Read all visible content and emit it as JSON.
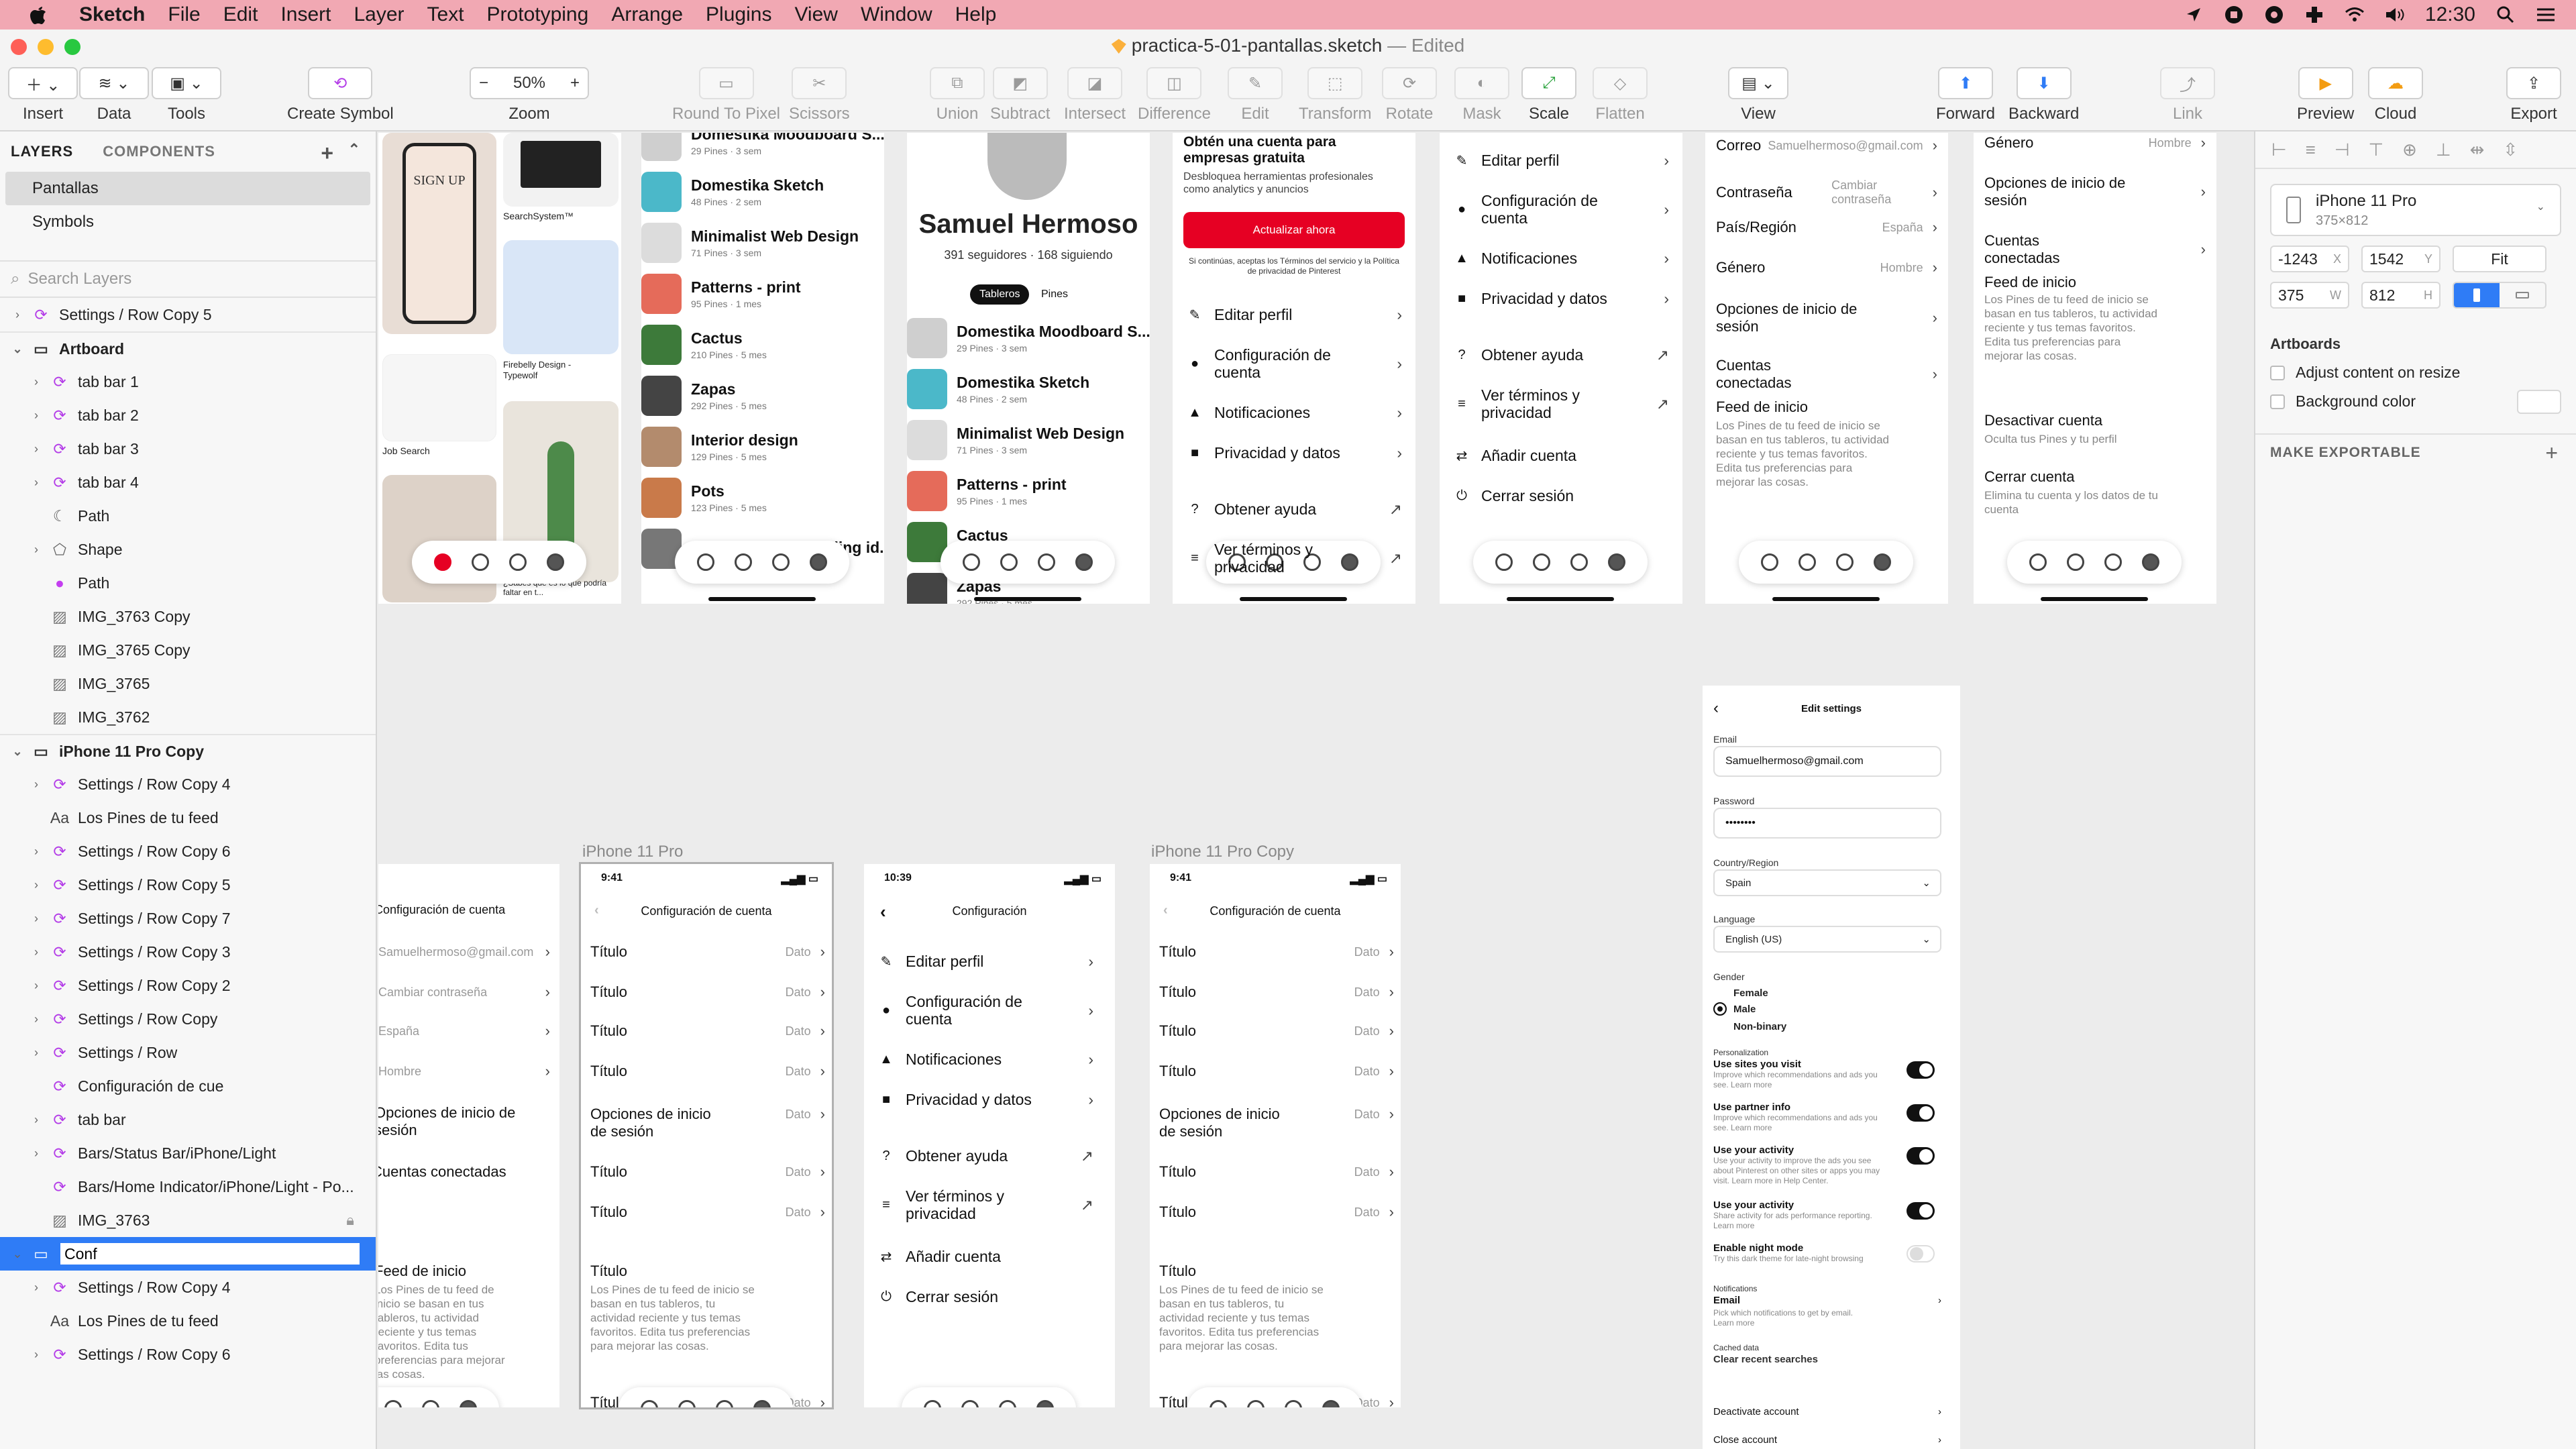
{
  "menubar": {
    "items": [
      "Sketch",
      "File",
      "Edit",
      "Insert",
      "Layer",
      "Text",
      "Prototyping",
      "Arrange",
      "Plugins",
      "View",
      "Window",
      "Help"
    ],
    "time": "12:30"
  },
  "window": {
    "title": "practica-5-01-pantallas.sketch",
    "edited": "— Edited"
  },
  "toolbar": {
    "insert": "Insert",
    "data": "Data",
    "tools": "Tools",
    "create_symbol": "Create Symbol",
    "zoom_value": "50%",
    "zoom": "Zoom",
    "round_to_pixel": "Round To Pixel",
    "scissors": "Scissors",
    "union": "Union",
    "subtract": "Subtract",
    "intersect": "Intersect",
    "difference": "Difference",
    "edit": "Edit",
    "transform": "Transform",
    "rotate": "Rotate",
    "mask": "Mask",
    "scale": "Scale",
    "flatten": "Flatten",
    "view": "View",
    "forward": "Forward",
    "backward": "Backward",
    "link": "Link",
    "preview": "Preview",
    "cloud": "Cloud",
    "export": "Export"
  },
  "left_panel": {
    "tab_layers": "LAYERS",
    "tab_components": "COMPONENTS",
    "pages": [
      "Pantallas",
      "Symbols"
    ],
    "search_placeholder": "Search Layers",
    "layers": [
      {
        "name": "Settings / Row Copy 5",
        "icon": "symbol-icon",
        "indent": 0,
        "arrow": "›"
      },
      {
        "name": "Artboard",
        "icon": "artboard-icon",
        "indent": 0,
        "arrow": "⌄",
        "group": true
      },
      {
        "name": "tab bar 1",
        "icon": "symbol-icon",
        "indent": 1,
        "arrow": "›"
      },
      {
        "name": "tab bar 2",
        "icon": "symbol-icon",
        "indent": 1,
        "arrow": "›"
      },
      {
        "name": "tab bar 3",
        "icon": "symbol-icon",
        "indent": 1,
        "arrow": "›"
      },
      {
        "name": "tab bar 4",
        "icon": "symbol-icon",
        "indent": 1,
        "arrow": "›"
      },
      {
        "name": "Path",
        "icon": "path-icon",
        "indent": 1,
        "arrow": ""
      },
      {
        "name": "Shape",
        "icon": "shape-icon",
        "indent": 1,
        "arrow": "›"
      },
      {
        "name": "Path",
        "icon": "path-pink-icon",
        "indent": 1,
        "arrow": ""
      },
      {
        "name": "IMG_3763 Copy",
        "icon": "image-icon",
        "indent": 1,
        "arrow": ""
      },
      {
        "name": "IMG_3765 Copy",
        "icon": "image-icon",
        "indent": 1,
        "arrow": ""
      },
      {
        "name": "IMG_3765",
        "icon": "image-icon",
        "indent": 1,
        "arrow": ""
      },
      {
        "name": "IMG_3762",
        "icon": "image-icon",
        "indent": 1,
        "arrow": ""
      },
      {
        "name": "iPhone 11 Pro Copy",
        "icon": "artboard-icon",
        "indent": 0,
        "arrow": "⌄",
        "group": true
      },
      {
        "name": "Settings / Row Copy 4",
        "icon": "symbol-icon",
        "indent": 1,
        "arrow": "›"
      },
      {
        "name": "Los Pines de tu feed",
        "icon": "text-icon",
        "indent": 1,
        "arrow": ""
      },
      {
        "name": "Settings / Row Copy 6",
        "icon": "symbol-icon",
        "indent": 1,
        "arrow": "›"
      },
      {
        "name": "Settings / Row Copy 5",
        "icon": "symbol-icon",
        "indent": 1,
        "arrow": "›"
      },
      {
        "name": "Settings / Row Copy 7",
        "icon": "symbol-icon",
        "indent": 1,
        "arrow": "›"
      },
      {
        "name": "Settings / Row Copy 3",
        "icon": "symbol-icon",
        "indent": 1,
        "arrow": "›"
      },
      {
        "name": "Settings / Row Copy 2",
        "icon": "symbol-icon",
        "indent": 1,
        "arrow": "›"
      },
      {
        "name": "Settings / Row Copy",
        "icon": "symbol-icon",
        "indent": 1,
        "arrow": "›"
      },
      {
        "name": "Settings / Row",
        "icon": "symbol-icon",
        "indent": 1,
        "arrow": "›"
      },
      {
        "name": "Configuración de cue",
        "icon": "symbol-icon",
        "indent": 1,
        "arrow": ""
      },
      {
        "name": "tab bar",
        "icon": "symbol-icon",
        "indent": 1,
        "arrow": "›"
      },
      {
        "name": "Bars/Status Bar/iPhone/Light",
        "icon": "symbol-icon",
        "indent": 1,
        "arrow": "›"
      },
      {
        "name": "Bars/Home Indicator/iPhone/Light - Po...",
        "icon": "symbol-icon",
        "indent": 1,
        "arrow": ""
      },
      {
        "name": "IMG_3763",
        "icon": "image-icon",
        "indent": 1,
        "arrow": "",
        "locked": true
      },
      {
        "name": "Conf",
        "icon": "artboard-icon",
        "indent": 0,
        "arrow": "⌄",
        "editing": true
      },
      {
        "name": "Settings / Row Copy 4",
        "icon": "symbol-icon",
        "indent": 1,
        "arrow": "›"
      },
      {
        "name": "Los Pines de tu feed",
        "icon": "text-icon",
        "indent": 1,
        "arrow": ""
      },
      {
        "name": "Settings / Row Copy 6",
        "icon": "symbol-icon",
        "indent": 1,
        "arrow": "›"
      }
    ]
  },
  "inspector": {
    "device_name": "iPhone 11 Pro",
    "device_size": "375×812",
    "x": "-1243",
    "x_unit": "X",
    "y": "1542",
    "y_unit": "Y",
    "w": "375",
    "w_unit": "W",
    "h": "812",
    "h_unit": "H",
    "fit": "Fit",
    "artboards_title": "Artboards",
    "adjust": "Adjust content on resize",
    "bg_color": "Background color",
    "exportable": "MAKE EXPORTABLE"
  },
  "canvas": {
    "signup_text": "SIGN UP",
    "search_system": "SearchSystem™",
    "firebelly": "Firebelly Design - Typewolf",
    "job_search": "Job Search",
    "saber": "¿Sabes qué es lo que podría faltar en t...",
    "boards": [
      {
        "title": "Domestika Moodboard S...",
        "sub": "29 Pines · 3 sem",
        "color": "#cfcfcf"
      },
      {
        "title": "Domestika Sketch",
        "sub": "48 Pines · 2 sem",
        "color": "#4bb8c9"
      },
      {
        "title": "Minimalist Web Design",
        "sub": "71 Pines · 3 sem",
        "color": "#dcdcdc"
      },
      {
        "title": "Patterns - print",
        "sub": "95 Pines · 1 mes",
        "color": "#e56b5a"
      },
      {
        "title": "Cactus",
        "sub": "210 Pines · 5 mes",
        "color": "#3d7a3a"
      },
      {
        "title": "Zapas",
        "sub": "292 Pines · 5 mes",
        "color": "#444"
      },
      {
        "title": "Interior design",
        "sub": "129 Pines · 5 mes",
        "color": "#b38b6d"
      },
      {
        "title": "Pots",
        "sub": "123 Pines · 5 mes",
        "color": "#c97a4a"
      },
      {
        "title": "Elastic Heads branding id...",
        "sub": "",
        "color": "#777"
      }
    ],
    "profile": {
      "name": "Samuel Hermoso",
      "stats": "391 seguidores · 168 siguiendo",
      "tab1": "Tableros",
      "tab2": "Pines"
    },
    "business": {
      "title": "Obtén una cuenta para empresas gratuita",
      "desc": "Desbloquea herramientas profesionales como analytics y anuncios",
      "button": "Actualizar ahora",
      "legal": "Si continúas, aceptas los Términos del servicio y la Política de privacidad de Pinterest"
    },
    "menu": {
      "edit_profile": "Editar perfil",
      "account_settings": "Configuración de cuenta",
      "notifications": "Notificaciones",
      "privacy": "Privacidad y datos",
      "help": "Obtener ayuda",
      "terms": "Ver términos y privacidad",
      "add_account": "Añadir cuenta",
      "logout": "Cerrar sesión"
    },
    "account": {
      "email_label": "Correo",
      "email_value": "Samuelhermoso@gmail.com",
      "password_label": "Contraseña",
      "password_value": "Cambiar contraseña",
      "country_label": "País/Región",
      "country_value": "España",
      "gender_label": "Género",
      "gender_value": "Hombre",
      "login_opts": "Opciones de inicio de sesión",
      "connected": "Cuentas conectadas",
      "feed_label": "Feed de inicio",
      "feed_desc": "Los Pines de tu feed de inicio se basan en tus tableros, tu actividad reciente y tus temas favoritos. Edita tus preferencias para mejorar las cosas.",
      "deactivate": "Desactivar cuenta",
      "deactivate_desc": "Oculta tus Pines y tu perfil",
      "close": "Cerrar cuenta",
      "close_desc": "Elimina tu cuenta y los datos de tu cuenta",
      "title": "Configuración de cuenta",
      "config": "Configuración"
    },
    "template": {
      "title": "Título",
      "data": "Dato",
      "time": "9:41",
      "time2": "10:39"
    },
    "labels": {
      "iphone": "iPhone 11 Pro",
      "iphone_copy": "iPhone 11 Pro Copy"
    },
    "edit_settings": {
      "title": "Edit settings",
      "email_label": "Email",
      "email": "Samuelhermoso@gmail.com",
      "password_label": "Password",
      "password": "••••••••",
      "country_label": "Country/Region",
      "country": "Spain",
      "language_label": "Language",
      "language": "English (US)",
      "gender_label": "Gender",
      "female": "Female",
      "male": "Male",
      "nonbinary": "Non-binary",
      "personalization": "Personalization",
      "t1_title": "Use sites you visit",
      "t1_desc": "Improve which recommendations and ads you see. Learn more",
      "t2_title": "Use partner info",
      "t2_desc": "Improve which recommendations and ads you see. Learn more",
      "t3_title": "Use your activity",
      "t3_desc": "Use your activity to improve the ads you see about Pinterest on other sites or apps you may visit. Learn more in Help Center.",
      "t4_title": "Use your activity",
      "t4_desc": "Share activity for ads performance reporting. Learn more",
      "t5_title": "Enable night mode",
      "t5_desc": "Try this dark theme for late-night browsing",
      "notifications": "Notifications",
      "notif_email": "Email",
      "notif_desc": "Pick which notifications to get by email. Learn more",
      "cached": "Cached data",
      "clear": "Clear recent searches",
      "deactivate": "Deactivate account",
      "close": "Close account"
    }
  }
}
